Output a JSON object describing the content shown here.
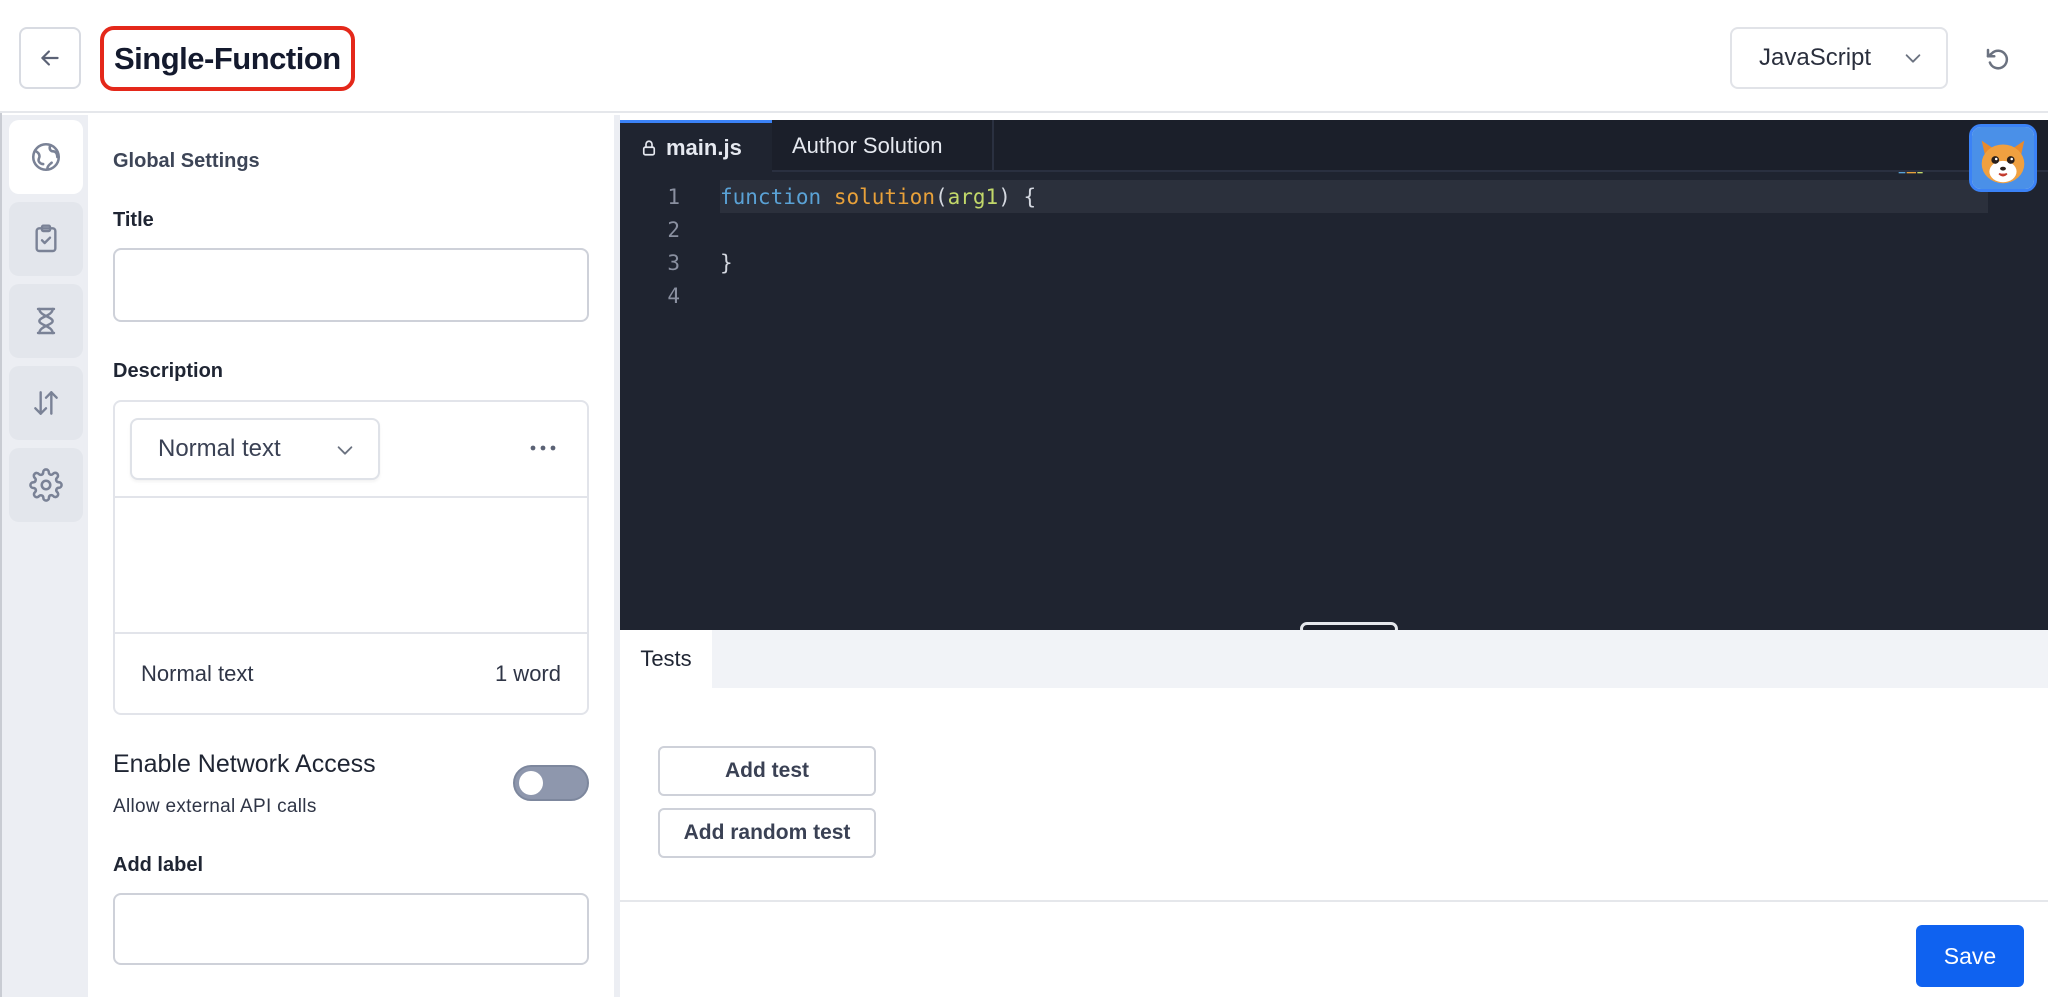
{
  "header": {
    "title": "Single-Function",
    "language": "JavaScript"
  },
  "settings": {
    "heading": "Global Settings",
    "title_label": "Title",
    "title_value": "",
    "description_label": "Description",
    "format_value": "Normal text",
    "footer_format": "Normal text",
    "word_count": "1 word",
    "network_title": "Enable Network Access",
    "network_subtitle": "Allow external API calls",
    "network_enabled": false,
    "add_label_label": "Add label",
    "add_label_value": ""
  },
  "editor": {
    "tabs": [
      "main.js",
      "Author Solution"
    ],
    "line_numbers": [
      "1",
      "2",
      "3",
      "4"
    ],
    "code": {
      "kw": "function",
      "fn": "solution",
      "arg": "arg1",
      "closing": "}"
    }
  },
  "tests": {
    "tab_label": "Tests",
    "add_test": "Add test",
    "add_random_test": "Add random test"
  },
  "footer": {
    "save_label": "Save"
  },
  "colors": {
    "accent": "#0f62f0",
    "title_highlight": "#e4281a",
    "editor_bg": "#1f2430"
  }
}
